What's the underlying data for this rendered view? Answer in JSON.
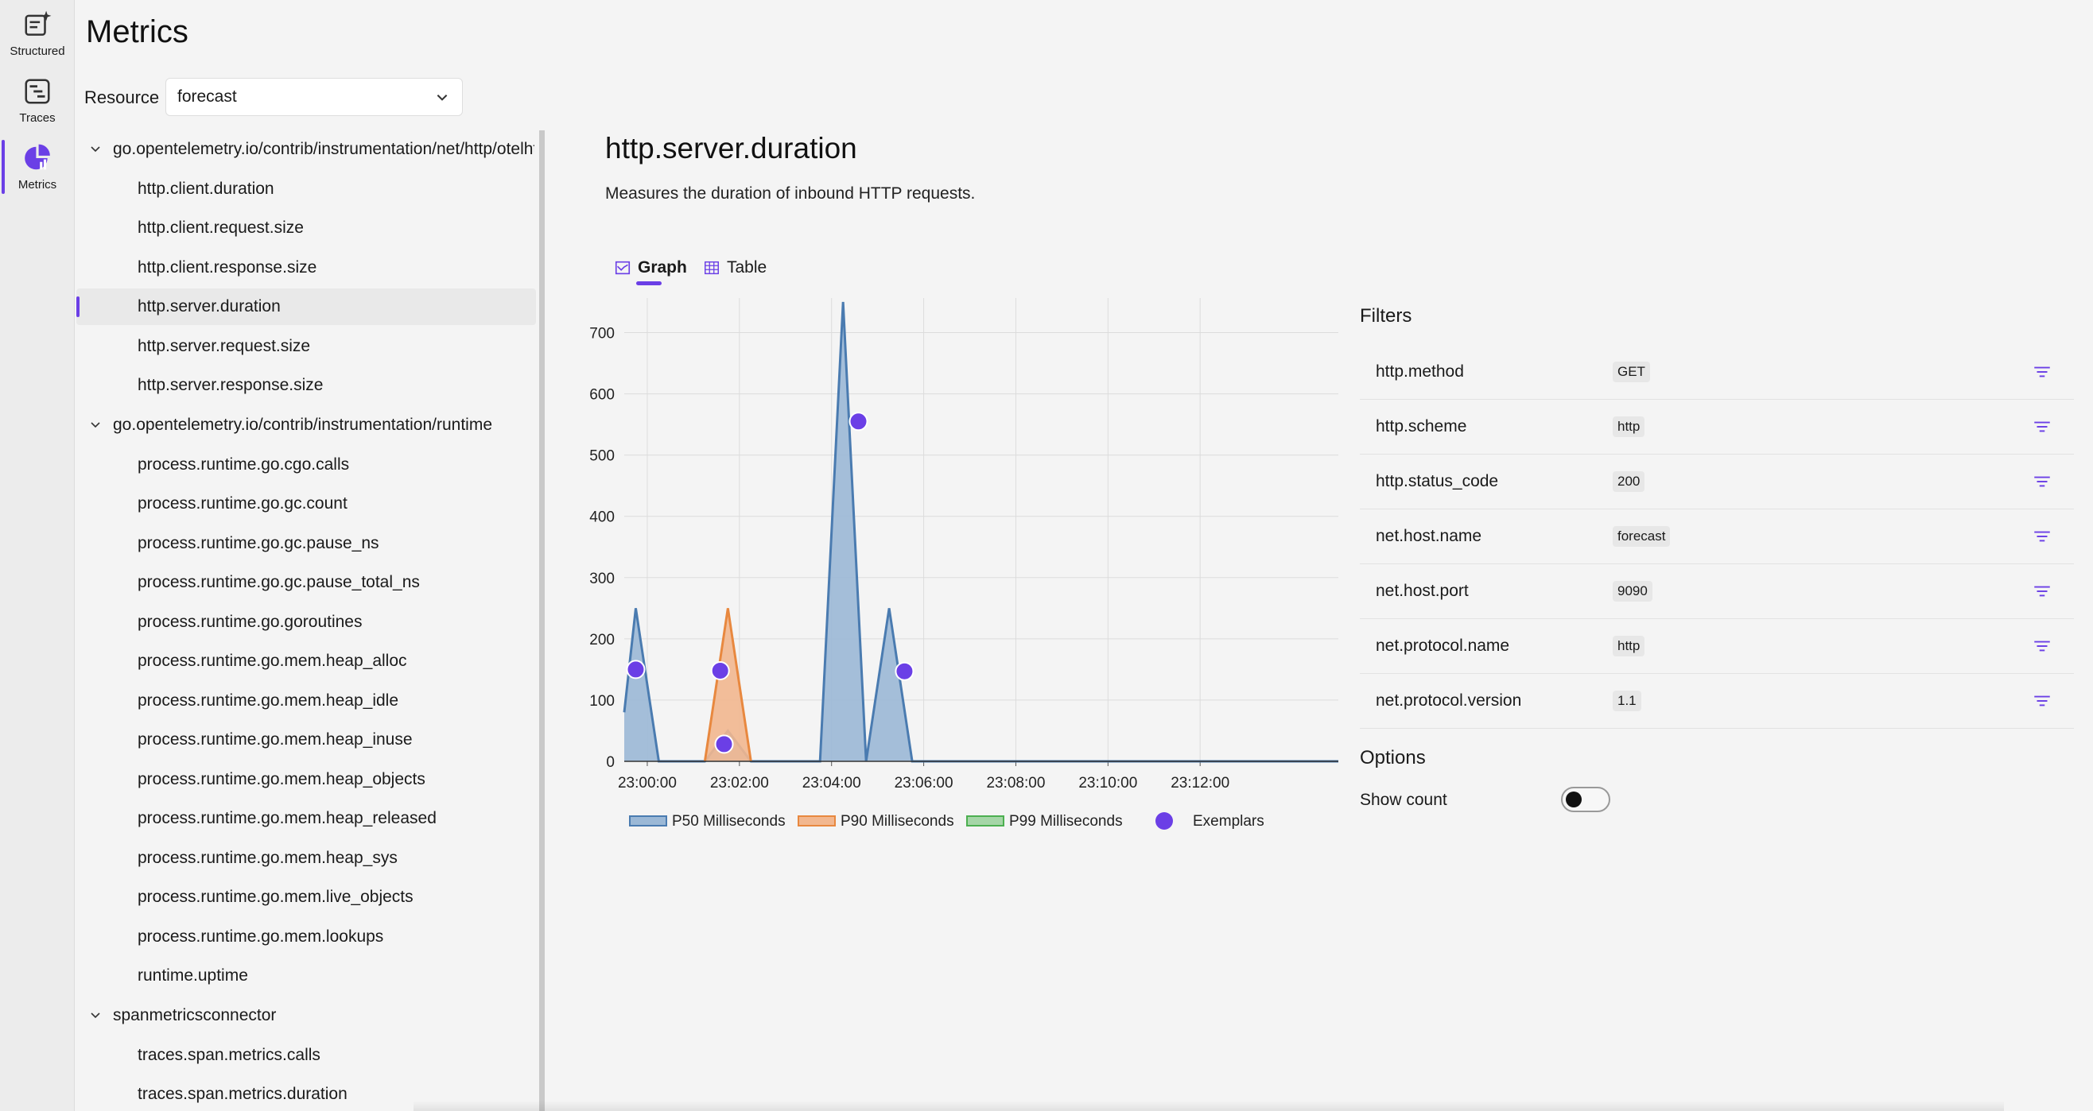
{
  "rail": [
    {
      "label": "Structured",
      "icon": "structured-icon",
      "active": false
    },
    {
      "label": "Traces",
      "icon": "traces-icon",
      "active": false
    },
    {
      "label": "Metrics",
      "icon": "metrics-icon",
      "active": true
    }
  ],
  "page_title": "Metrics",
  "resource": {
    "label": "Resource",
    "value": "forecast"
  },
  "tree": [
    {
      "group": "go.opentelemetry.io/contrib/instrumentation/net/http/otelhttp",
      "items": [
        "http.client.duration",
        "http.client.request.size",
        "http.client.response.size",
        "http.server.duration",
        "http.server.request.size",
        "http.server.response.size"
      ]
    },
    {
      "group": "go.opentelemetry.io/contrib/instrumentation/runtime",
      "items": [
        "process.runtime.go.cgo.calls",
        "process.runtime.go.gc.count",
        "process.runtime.go.gc.pause_ns",
        "process.runtime.go.gc.pause_total_ns",
        "process.runtime.go.goroutines",
        "process.runtime.go.mem.heap_alloc",
        "process.runtime.go.mem.heap_idle",
        "process.runtime.go.mem.heap_inuse",
        "process.runtime.go.mem.heap_objects",
        "process.runtime.go.mem.heap_released",
        "process.runtime.go.mem.heap_sys",
        "process.runtime.go.mem.live_objects",
        "process.runtime.go.mem.lookups",
        "runtime.uptime"
      ]
    },
    {
      "group": "spanmetricsconnector",
      "items": [
        "traces.span.metrics.calls",
        "traces.span.metrics.duration"
      ]
    }
  ],
  "selected_metric": "http.server.duration",
  "detail": {
    "title": "http.server.duration",
    "description": "Measures the duration of inbound HTTP requests.",
    "tabs": [
      {
        "label": "Graph",
        "active": true
      },
      {
        "label": "Table",
        "active": false
      }
    ]
  },
  "chart_data": {
    "type": "area",
    "x": [
      "22:59:30",
      "23:00:00",
      "23:00:30",
      "23:01:00",
      "23:01:30",
      "23:02:00",
      "23:02:30",
      "23:03:00",
      "23:03:30",
      "23:04:00",
      "23:04:30",
      "23:05:00",
      "23:05:30",
      "23:06:00"
    ],
    "x_ticks": [
      "23:00:00",
      "23:02:00",
      "23:04:00",
      "23:06:00",
      "23:08:00",
      "23:10:00",
      "23:12:00"
    ],
    "y_ticks": [
      0,
      100,
      200,
      300,
      400,
      500,
      600,
      700
    ],
    "ylim": [
      0,
      750
    ],
    "series": [
      {
        "name": "P50 Milliseconds",
        "color": "#4a7bb0",
        "points": [
          [
            "22:59:30",
            80
          ],
          [
            "22:59:45",
            250
          ],
          [
            "23:00:15",
            0
          ],
          [
            "23:01:15",
            0
          ],
          [
            "23:01:45",
            50
          ],
          [
            "23:02:15",
            0
          ],
          [
            "23:03:45",
            0
          ],
          [
            "23:04:15",
            750
          ],
          [
            "23:04:45",
            0
          ],
          [
            "23:05:15",
            250
          ],
          [
            "23:05:45",
            0
          ],
          [
            "23:15:00",
            0
          ]
        ]
      },
      {
        "name": "P90 Milliseconds",
        "color": "#e8883f",
        "points": [
          [
            "23:01:15",
            0
          ],
          [
            "23:01:45",
            250
          ],
          [
            "23:02:15",
            0
          ]
        ]
      },
      {
        "name": "P99 Milliseconds",
        "color": "#4caf50",
        "points": []
      }
    ],
    "exemplars": {
      "name": "Exemplars",
      "color": "#6b3fe6",
      "points": [
        [
          "22:59:45",
          150
        ],
        [
          "23:01:35",
          148
        ],
        [
          "23:01:40",
          28
        ],
        [
          "23:04:35",
          555
        ],
        [
          "23:05:35",
          147
        ]
      ]
    },
    "grid": true
  },
  "filters": {
    "title": "Filters",
    "rows": [
      {
        "name": "http.method",
        "value": "GET"
      },
      {
        "name": "http.scheme",
        "value": "http"
      },
      {
        "name": "http.status_code",
        "value": "200"
      },
      {
        "name": "net.host.name",
        "value": "forecast"
      },
      {
        "name": "net.host.port",
        "value": "9090"
      },
      {
        "name": "net.protocol.name",
        "value": "http"
      },
      {
        "name": "net.protocol.version",
        "value": "1.1"
      }
    ]
  },
  "options": {
    "title": "Options",
    "show_count_label": "Show count",
    "show_count": false
  },
  "colors": {
    "accent": "#6b3fe6"
  }
}
